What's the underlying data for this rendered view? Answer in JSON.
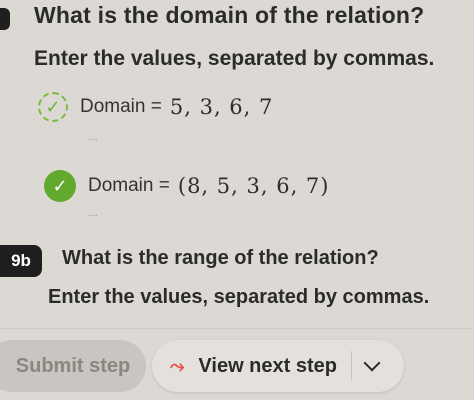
{
  "question1": {
    "title": "What is the domain of the relation?",
    "instruction": "Enter the values, separated by commas."
  },
  "attempt1": {
    "label": "Domain",
    "equals": "=",
    "value": "5, 3, 6, 7",
    "icon": "check-dashed-icon",
    "more": "…"
  },
  "attempt2": {
    "label": "Domain",
    "equals": "=",
    "value": "(8, 5, 3, 6, 7)",
    "icon": "check-circle-icon",
    "more": "…"
  },
  "question2": {
    "step": "9b",
    "title": "What is the range of the relation?",
    "instruction": "Enter the values, separated by commas."
  },
  "footer": {
    "submit_label": "Submit step",
    "next_label": "View next step"
  },
  "colors": {
    "success": "#62a92e",
    "accent_icon": "#e8534a",
    "disabled": "#c9c5c0"
  }
}
